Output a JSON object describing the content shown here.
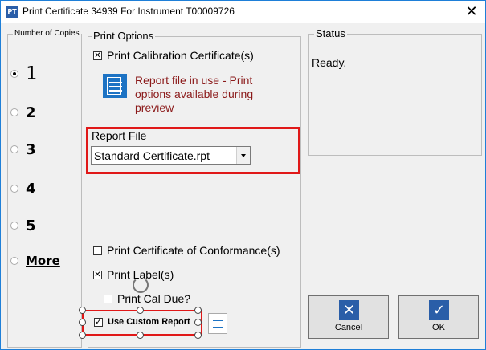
{
  "window": {
    "title": "Print Certificate 34939 For Instrument T00009726",
    "app_icon_text": "PT",
    "close_glyph": "✕"
  },
  "copies": {
    "label": "Number of Copies",
    "options": [
      "1",
      "2",
      "3",
      "4",
      "5",
      "More"
    ],
    "selected": "1"
  },
  "print_options": {
    "label": "Print Options",
    "calibration_certificate": {
      "label": "Print Calibration Certificate(s)",
      "checked": true
    },
    "warning": "Report file in use - Print options available during preview",
    "report_file_label": "Report File",
    "report_file_value": "Standard Certificate.rpt",
    "conformance": {
      "label": "Print Certificate of Conformance(s)",
      "checked": false
    },
    "labels": {
      "label": "Print Label(s)",
      "checked": true
    },
    "cal_due": {
      "label": "Print Cal Due?",
      "checked": false
    },
    "custom_report": {
      "label": "Use Custom Report",
      "checked": true
    }
  },
  "status": {
    "label": "Status",
    "text": "Ready."
  },
  "buttons": {
    "cancel": "Cancel",
    "ok": "OK"
  },
  "colors": {
    "highlight": "#e01818",
    "warning_text": "#8b1a1a",
    "icon_blue": "#1d73c4"
  }
}
